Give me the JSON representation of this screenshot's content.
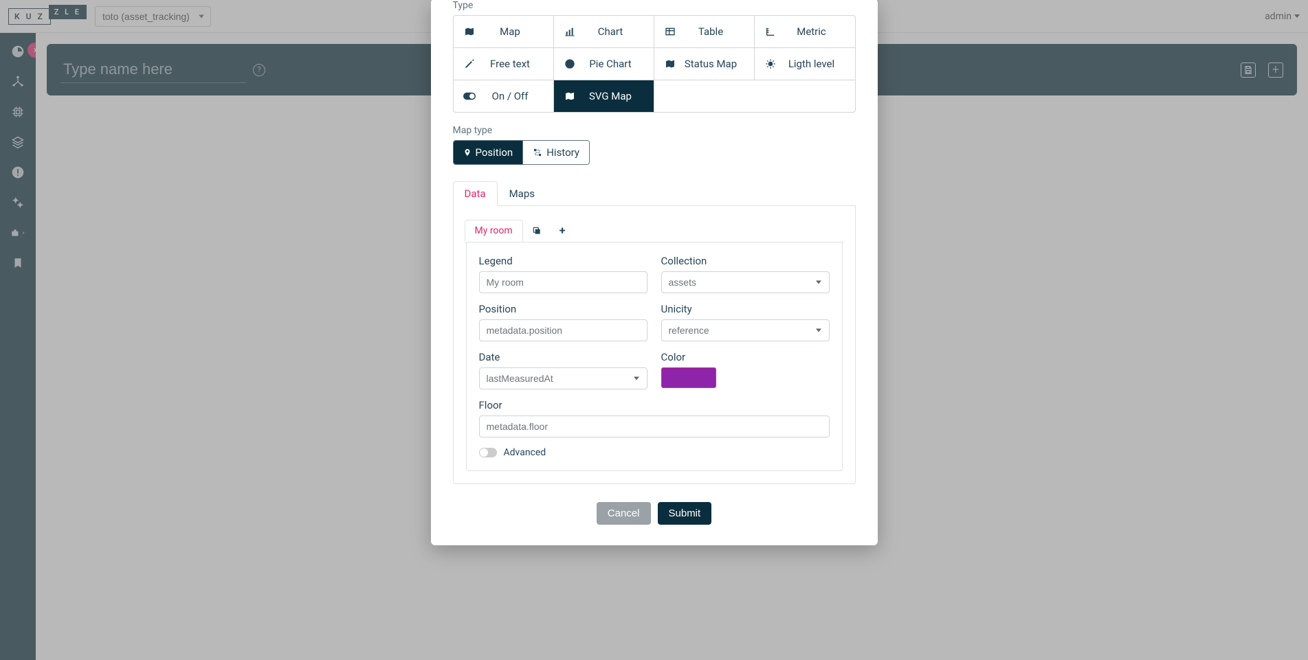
{
  "header": {
    "logo_left": "K U Z",
    "logo_right": "Z L E",
    "env_select": "toto (asset_tracking)",
    "user": "admin"
  },
  "name_bar": {
    "placeholder": "Type name here"
  },
  "modal": {
    "type_label": "Type",
    "types": {
      "map": "Map",
      "chart": "Chart",
      "table": "Table",
      "metric": "Metric",
      "free_text": "Free text",
      "pie_chart": "Pie Chart",
      "status_map": "Status Map",
      "light_level": "Ligth level",
      "on_off": "On / Off",
      "svg_map": "SVG Map"
    },
    "map_type_label": "Map type",
    "map_types": {
      "position": "Position",
      "history": "History"
    },
    "tabs": {
      "data": "Data",
      "maps": "Maps"
    },
    "room_tab": "My room",
    "form": {
      "legend_label": "Legend",
      "legend_value": "My room",
      "collection_label": "Collection",
      "collection_value": "assets",
      "position_label": "Position",
      "position_value": "metadata.position",
      "unicity_label": "Unicity",
      "unicity_value": "reference",
      "date_label": "Date",
      "date_value": "lastMeasuredAt",
      "color_label": "Color",
      "color_value": "#8e24aa",
      "floor_label": "Floor",
      "floor_value": "metadata.floor",
      "advanced_label": "Advanced"
    },
    "actions": {
      "cancel": "Cancel",
      "submit": "Submit"
    }
  }
}
